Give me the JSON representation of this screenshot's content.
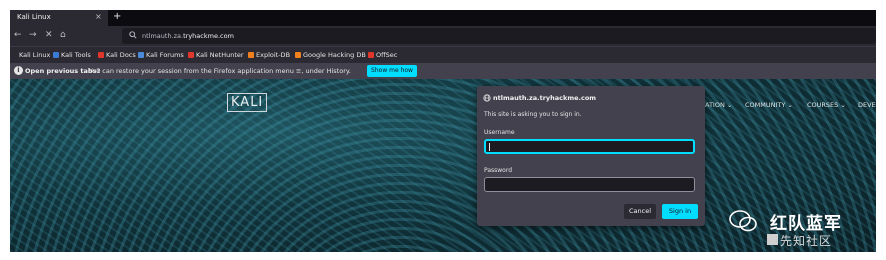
{
  "tab": {
    "title": "Kali Linux",
    "close": "×",
    "new_tab": "+"
  },
  "nav": {
    "back": "←",
    "forward": "→",
    "stop": "✕",
    "home": "⌂",
    "url_prefix": "ntlmauth.za.",
    "url_host": "tryhackme.com"
  },
  "bookmarks": [
    {
      "label": "Kali Linux",
      "color": "#2b2a33"
    },
    {
      "label": "Kali Tools",
      "color": "#3a7bd5"
    },
    {
      "label": "Kali Docs",
      "color": "#e0362c"
    },
    {
      "label": "Kali Forums",
      "color": "#4a8ad8"
    },
    {
      "label": "Kali NetHunter",
      "color": "#e0362c"
    },
    {
      "label": "Exploit-DB",
      "color": "#f0801e"
    },
    {
      "label": "Google Hacking DB",
      "color": "#f0801e"
    },
    {
      "label": "OffSec",
      "color": "#e0362c"
    }
  ],
  "notice": {
    "bold": "Open previous tabs?",
    "text": "You can restore your session from the Firefox application menu ≡, under History.",
    "button": "Show me how"
  },
  "site": {
    "logo": "KALI",
    "menu": [
      "ATION ⌄",
      "COMMUNITY ⌄",
      "COURSES ⌄",
      "DEVE"
    ]
  },
  "dialog": {
    "host": "ntlmauth.za.tryhackme.com",
    "message": "This site is asking you to sign in.",
    "username_label": "Username",
    "username_value": "",
    "password_label": "Password",
    "password_value": "",
    "cancel": "Cancel",
    "signin": "Sign in"
  },
  "watermark": {
    "title": "红队蓝军",
    "subtitle": "先知社区"
  },
  "colors": {
    "accent": "#00ddff",
    "panel": "#42414d",
    "chrome": "#2b2a33"
  }
}
